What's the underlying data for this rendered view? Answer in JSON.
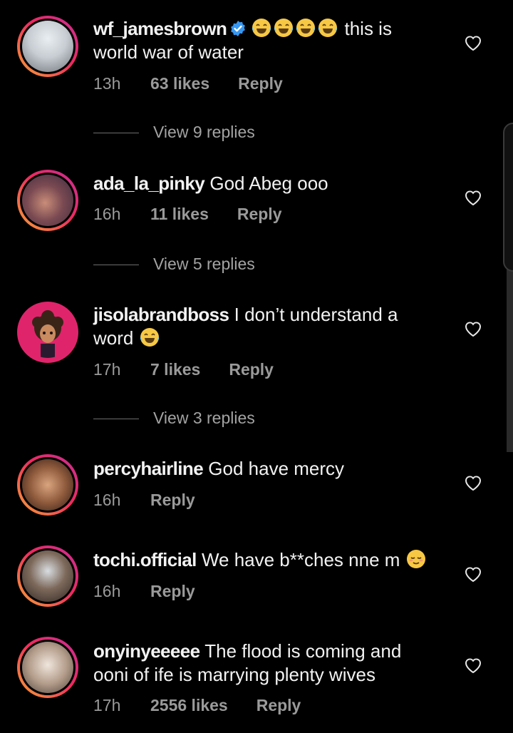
{
  "comments": [
    {
      "username": "wf_jamesbrown",
      "verified": true,
      "text_line1": "this is",
      "text_line2": "world war of water",
      "emojis": [
        "laughing-tears",
        "laughing-tears",
        "laughing-tears",
        "laughing-tears"
      ],
      "time": "13h",
      "likes": "63 likes",
      "reply": "Reply",
      "view_replies": "View 9 replies"
    },
    {
      "username": "ada_la_pinky",
      "text": "God Abeg ooo",
      "time": "16h",
      "likes": "11 likes",
      "reply": "Reply",
      "view_replies": "View 5 replies"
    },
    {
      "username": "jisolabrandboss",
      "text_line1": "I don’t understand a",
      "text_line2": "word",
      "emojis": [
        "laughing-tears"
      ],
      "time": "17h",
      "likes": "7 likes",
      "reply": "Reply",
      "view_replies": "View 3 replies"
    },
    {
      "username": "percyhairline",
      "text": "God have mercy",
      "time": "16h",
      "reply": "Reply"
    },
    {
      "username": "tochi.official",
      "text": "We have b**ches nne m",
      "emojis": [
        "relieved-face"
      ],
      "time": "16h",
      "reply": "Reply"
    },
    {
      "username": "onyinyeeeee",
      "text_line1": "The flood is coming and",
      "text_line2": "ooni of ife is marrying plenty wives",
      "time": "17h",
      "likes": "2556 likes",
      "reply": "Reply"
    }
  ],
  "icons": {
    "like": "heart-outline-icon",
    "verified": "verified-badge-icon"
  },
  "colors": {
    "background": "#000000",
    "text": "#f2f2f2",
    "meta": "#9a9a9a",
    "verified": "#3797f0",
    "story_ring_start": "#f7a534",
    "story_ring_end": "#c52f96"
  }
}
